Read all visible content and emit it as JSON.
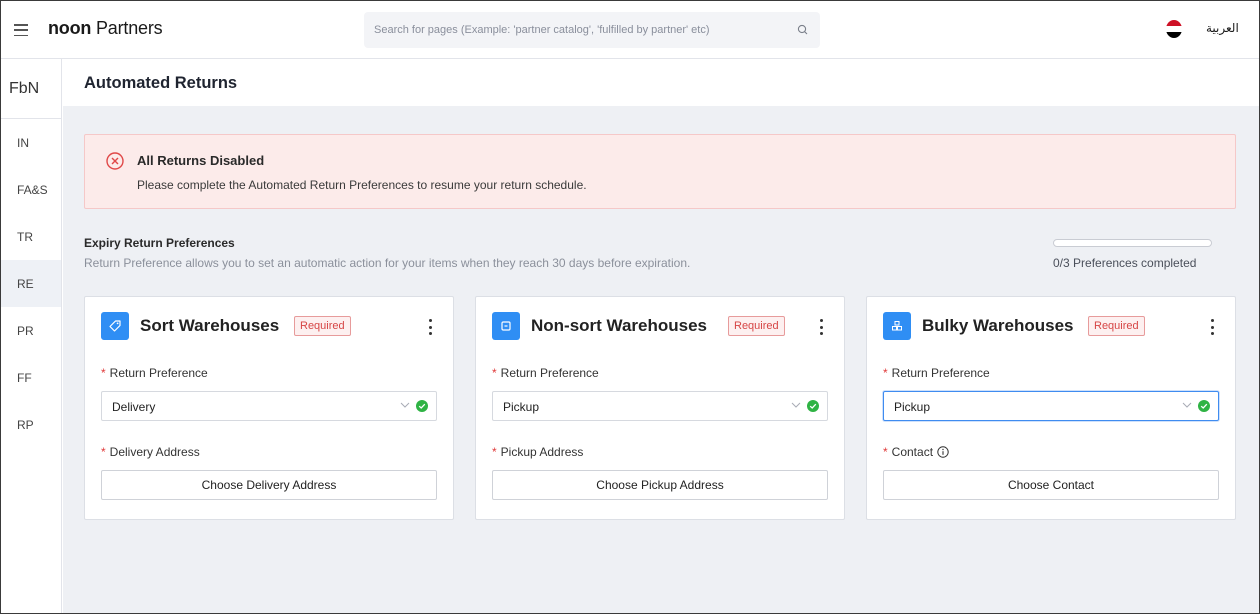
{
  "header": {
    "logo_bold": "noon",
    "logo_rest": " Partners",
    "search_placeholder": "Search for pages (Example: 'partner catalog', 'fulfilled by partner' etc)",
    "language": "العربية"
  },
  "sidebar": {
    "title": "FbN",
    "items": [
      {
        "label": "IN"
      },
      {
        "label": "FA&S"
      },
      {
        "label": "TR"
      },
      {
        "label": "RE"
      },
      {
        "label": "PR"
      },
      {
        "label": "FF"
      },
      {
        "label": "RP"
      }
    ],
    "active_index": 3
  },
  "page": {
    "title": "Automated Returns"
  },
  "alert": {
    "title": "All Returns Disabled",
    "message": "Please complete the Automated Return Preferences to resume your return schedule."
  },
  "preferences": {
    "title": "Expiry Return Preferences",
    "subtitle": "Return Preference allows you to set an automatic action for your items when they reach 30 days before expiration.",
    "progress_text": "0/3 Preferences completed",
    "progress_fraction": 0
  },
  "cards": [
    {
      "icon": "tag-icon",
      "title": "Sort Warehouses",
      "badge": "Required",
      "pref_label": "Return Preference",
      "pref_value": "Delivery",
      "address_label": "Delivery Address",
      "button": "Choose Delivery Address"
    },
    {
      "icon": "box-icon",
      "title": "Non-sort Warehouses",
      "badge": "Required",
      "pref_label": "Return Preference",
      "pref_value": "Pickup",
      "address_label": "Pickup Address",
      "button": "Choose Pickup Address"
    },
    {
      "icon": "boxes-icon",
      "title": "Bulky Warehouses",
      "badge": "Required",
      "pref_label": "Return Preference",
      "pref_value": "Pickup",
      "address_label": "Contact",
      "button": "Choose Contact"
    }
  ],
  "colors": {
    "accent_blue": "#2f8ef4",
    "alert_bg": "#fcebea",
    "required_red": "#d64545",
    "success_green": "#2fb344",
    "flag_red": "#ce1126",
    "flag_white": "#ffffff",
    "flag_black": "#000000"
  }
}
